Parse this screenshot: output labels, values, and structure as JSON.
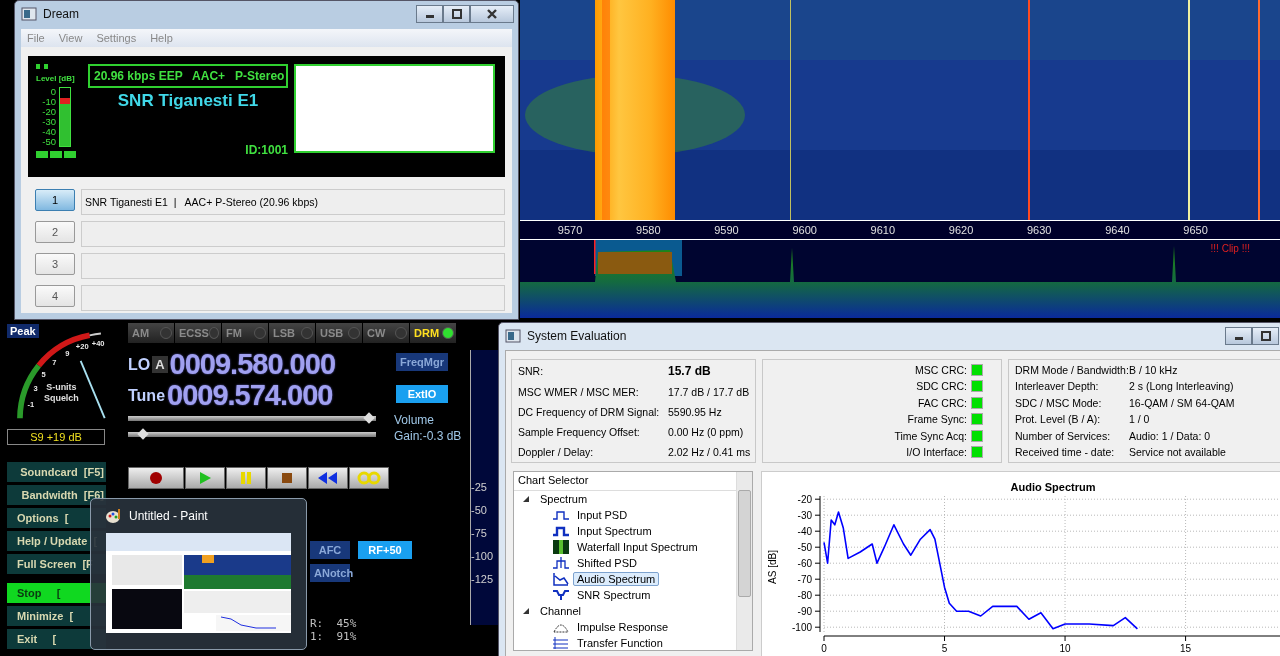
{
  "spectrum": {
    "freq_ticks": [
      "9570",
      "9580",
      "9590",
      "9600",
      "9610",
      "9620",
      "9630",
      "9640",
      "9650"
    ],
    "clip": "!!! Clip !!!"
  },
  "receiver": {
    "peak": "Peak",
    "meter_ticks": [
      "-1",
      "3",
      "5",
      "7",
      "9",
      "+20",
      "+40"
    ],
    "meter_caption": [
      "S-units",
      "Squelch"
    ],
    "meter": {
      "level": 0.76
    },
    "reading": "S9 +19 dB",
    "modes": [
      {
        "label": "AM",
        "selected": false
      },
      {
        "label": "ECSS",
        "selected": false
      },
      {
        "label": "FM",
        "selected": false
      },
      {
        "label": "LSB",
        "selected": false
      },
      {
        "label": "USB",
        "selected": false
      },
      {
        "label": "CW",
        "selected": false
      },
      {
        "label": "DRM",
        "selected": true
      }
    ],
    "lo_label": "LO",
    "lo_bank": "A",
    "lo_freq": "0009.580.000",
    "tune_label": "Tune",
    "tune_freq": "0009.574.000",
    "top_buttons": [
      {
        "label": "FreqMgr",
        "on": false
      },
      {
        "label": "ExtIO",
        "on": true
      }
    ],
    "volume_label": "Volume",
    "gain": "Gain:-0.3 dB",
    "volume": {
      "level": 0.97
    },
    "gain_slider": {
      "level": 0.06
    },
    "side_buttons": [
      {
        "label": "Soundcard  [F5]",
        "selected": false
      },
      {
        "label": "Bandwidth  [F6]",
        "selected": false
      },
      {
        "label": "Options  [",
        "selected": false
      },
      {
        "label": "Help / Update  [",
        "selected": false
      },
      {
        "label": "Full Screen  [F",
        "selected": false
      },
      {
        "label": "Stop     [",
        "selected": true
      },
      {
        "label": "Minimize  [",
        "selected": false
      },
      {
        "label": "Exit     [",
        "selected": false
      }
    ],
    "dsp_buttons": [
      {
        "label": "AFC",
        "on": false
      },
      {
        "label": "RF+50",
        "on": true
      }
    ],
    "notch": {
      "label": "ANotch",
      "on": false
    },
    "scale_ticks": [
      "-25",
      "-50",
      "-75",
      "-100",
      "-125"
    ],
    "stats": [
      "R:  45%",
      "1:  91%"
    ]
  },
  "dream": {
    "title": "Dream",
    "menu": [
      "File",
      "View",
      "Settings",
      "Help"
    ],
    "level_label": "Level [dB]",
    "level_ticks": [
      "0",
      "-10",
      "-20",
      "-30",
      "-40",
      "-50"
    ],
    "level": 0.82,
    "codec": "20.96 kbps EEP   AAC+   P-Stereo",
    "station": "SNR Tiganesti E1",
    "id": "ID:1001",
    "services": [
      {
        "number": "1",
        "label": "SNR Tiganesti E1  |   AAC+ P-Stereo (20.96 kbps)",
        "selected": true
      },
      {
        "number": "2",
        "selected": false
      },
      {
        "number": "3",
        "selected": false
      },
      {
        "number": "4",
        "selected": false
      }
    ]
  },
  "taskbar_preview": {
    "title": "Untitled - Paint"
  },
  "system_evaluation": {
    "title": "System Evaluation",
    "metrics": [
      {
        "label": "SNR:",
        "value": "15.7 dB"
      },
      {
        "label": "MSC WMER / MSC MER:",
        "value": "17.7 dB / 17.7 dB"
      },
      {
        "label": "DC Frequency of DRM Signal:",
        "value": "5590.95 Hz"
      },
      {
        "label": "Sample Frequency Offset:",
        "value": "0.00 Hz (0 ppm)"
      },
      {
        "label": "Doppler / Delay:",
        "value": "2.02 Hz / 0.41 ms"
      }
    ],
    "indicators": [
      {
        "label": "MSC CRC:",
        "ok": true
      },
      {
        "label": "SDC CRC:",
        "ok": true
      },
      {
        "label": "FAC CRC:",
        "ok": true
      },
      {
        "label": "Frame Sync:",
        "ok": true
      },
      {
        "label": "Time Sync Acq:",
        "ok": true
      },
      {
        "label": "I/O Interface:",
        "ok": true
      }
    ],
    "info": [
      {
        "label": "DRM Mode / Bandwidth:",
        "value": "B / 10 kHz"
      },
      {
        "label": "Interleaver Depth:",
        "value": "2 s (Long Interleaving)"
      },
      {
        "label": "SDC / MSC Mode:",
        "value": "16-QAM / SM 64-QAM"
      },
      {
        "label": "Prot. Level (B / A):",
        "value": "1 / 0"
      },
      {
        "label": "Number of Services:",
        "value": "Audio: 1 / Data: 0"
      },
      {
        "label": "Received time - date:",
        "value": "Service not available"
      }
    ],
    "chart_selector": {
      "title": "Chart Selector",
      "tree": [
        {
          "label": "Spectrum",
          "expanded": true,
          "children": [
            {
              "label": "Input PSD",
              "selected": false
            },
            {
              "label": "Input Spectrum",
              "selected": false
            },
            {
              "label": "Waterfall Input Spectrum",
              "selected": false
            },
            {
              "label": "Shifted PSD",
              "selected": false
            },
            {
              "label": "Audio Spectrum",
              "selected": true
            },
            {
              "label": "SNR Spectrum",
              "selected": false
            }
          ]
        },
        {
          "label": "Channel",
          "expanded": true,
          "children": [
            {
              "label": "Impulse Response",
              "selected": false
            },
            {
              "label": "Transfer Function",
              "selected": false
            }
          ]
        }
      ]
    },
    "chart": {
      "chart_data": {
        "type": "line",
        "title": "Audio Spectrum",
        "ylabel": "AS [dB]",
        "xlim": [
          0,
          19
        ],
        "ylim": [
          -103,
          -18
        ],
        "xticks": [
          0,
          5,
          10,
          15
        ],
        "yticks": [
          -20,
          -30,
          -40,
          -50,
          -60,
          -70,
          -80,
          -90,
          -100
        ],
        "x": [
          0,
          0.15,
          0.3,
          0.45,
          0.6,
          0.8,
          1,
          1.5,
          2,
          2.2,
          2.5,
          2.9,
          3.3,
          3.6,
          4,
          4.4,
          4.6,
          4.8,
          5,
          5.2,
          5.5,
          6,
          6.5,
          7,
          7.5,
          8,
          8.5,
          9,
          9.5,
          10,
          11,
          12,
          12.5,
          13
        ],
        "grid": true,
        "series": [
          {
            "color": "#0000ff",
            "values": [
              -47,
              -60,
              -33,
              -36,
              -28,
              -38,
              -57,
              -53,
              -48,
              -60,
              -50,
              -36,
              -48,
              -55,
              -45,
              -39,
              -45,
              -60,
              -75,
              -85,
              -90,
              -90,
              -93,
              -87,
              -87,
              -87,
              -95,
              -91,
              -101,
              -98,
              -98,
              -99,
              -94,
              -101
            ]
          }
        ]
      }
    }
  }
}
